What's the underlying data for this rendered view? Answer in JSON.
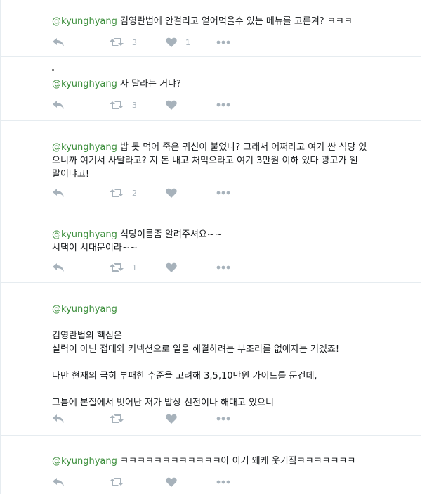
{
  "tweets": [
    {
      "handle": "@kyunghyang",
      "lines": [
        " 김영란법에 안걸리고 얻어먹을수 있는 메뉴를 고른겨? ㅋㅋㅋ"
      ],
      "retweets": "3",
      "likes": "1"
    },
    {
      "handle": "@kyunghyang",
      "lines": [
        " 사 달라는 거냐?"
      ],
      "retweets": "3",
      "likes": ""
    },
    {
      "handle": "@kyunghyang",
      "lines": [
        "  밥 못 먹어 죽은 귀신이 붙었나? 그래서 어쩌라고 여기 싼 식당 있",
        "으니까 여기서 사달라고?  지 돈 내고 처먹으라고 여기 3만원 이하 있다 광고가 웬",
        "말이냐고!"
      ],
      "retweets": "2",
      "likes": ""
    },
    {
      "handle": "@kyunghyang",
      "lines": [
        " 식당이름좀 알려주셔요~~",
        "시댁이 서대문이라~~"
      ],
      "retweets": "1",
      "likes": ""
    },
    {
      "handle": "@kyunghyang",
      "lines": [
        "",
        "",
        "김영란법의 핵심은",
        "실력이 아닌 접대와 커넥션으로 일을 해결하려는 부조리를 없애자는 거겠죠!",
        "",
        "다만 현재의 극히 부패한 수준을 고려해 3,5,10만원 가이드를 둔건데,",
        "",
        "그틈에 본질에서 벗어난 저가 밥상 선전이나 해대고 있으니"
      ],
      "retweets": "",
      "likes": ""
    },
    {
      "handle": "@kyunghyang",
      "lines": [
        " ㅋㅋㅋㅋㅋㅋㅋㅋㅋㅋㅋㅋ아 이거 왜케 웃기짘ㅋㅋㅋㅋㅋㅋㅋ"
      ],
      "retweets": "",
      "likes": ""
    }
  ],
  "colors": {
    "handle": "#3b8e3b",
    "icon": "#a7b2bb",
    "divider": "#e6ecf0"
  },
  "icons": [
    "reply-icon",
    "retweet-icon",
    "heart-icon",
    "more-icon"
  ]
}
